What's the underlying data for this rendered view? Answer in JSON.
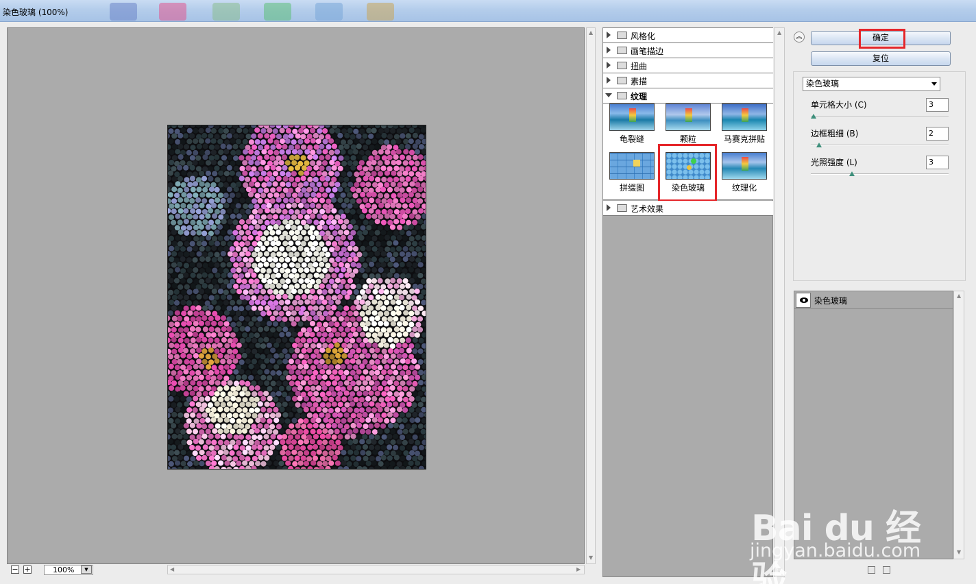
{
  "window": {
    "title": "染色玻璃 (100%)"
  },
  "preview": {
    "zoom": "100%"
  },
  "filter_categories": [
    {
      "label": "风格化",
      "expanded": false
    },
    {
      "label": "画笔描边",
      "expanded": false
    },
    {
      "label": "扭曲",
      "expanded": false
    },
    {
      "label": "素描",
      "expanded": false
    },
    {
      "label": "纹理",
      "expanded": true
    },
    {
      "label": "艺术效果",
      "expanded": false
    }
  ],
  "texture_filters": [
    {
      "label": "龟裂缝",
      "selected": false
    },
    {
      "label": "颗粒",
      "selected": false
    },
    {
      "label": "马赛克拼贴",
      "selected": false
    },
    {
      "label": "拼缀图",
      "selected": false
    },
    {
      "label": "染色玻璃",
      "selected": true
    },
    {
      "label": "纹理化",
      "selected": false
    }
  ],
  "buttons": {
    "ok": "确定",
    "reset": "复位"
  },
  "settings": {
    "selected_filter": "染色玻璃",
    "params": [
      {
        "label": "单元格大小 (C)",
        "value": "3",
        "fraction": 0.02
      },
      {
        "label": "边框粗细 (B)",
        "value": "2",
        "fraction": 0.06
      },
      {
        "label": "光照强度 (L)",
        "value": "3",
        "fraction": 0.3
      }
    ]
  },
  "layers": [
    {
      "name": "染色玻璃",
      "visible": true
    }
  ],
  "watermark": {
    "brand": "Bai du 经验",
    "url": "jingyan.baidu.com"
  },
  "colors": {
    "highlight": "#e5262a",
    "slider": "#3d8f7b",
    "canvas": "#ababab"
  }
}
